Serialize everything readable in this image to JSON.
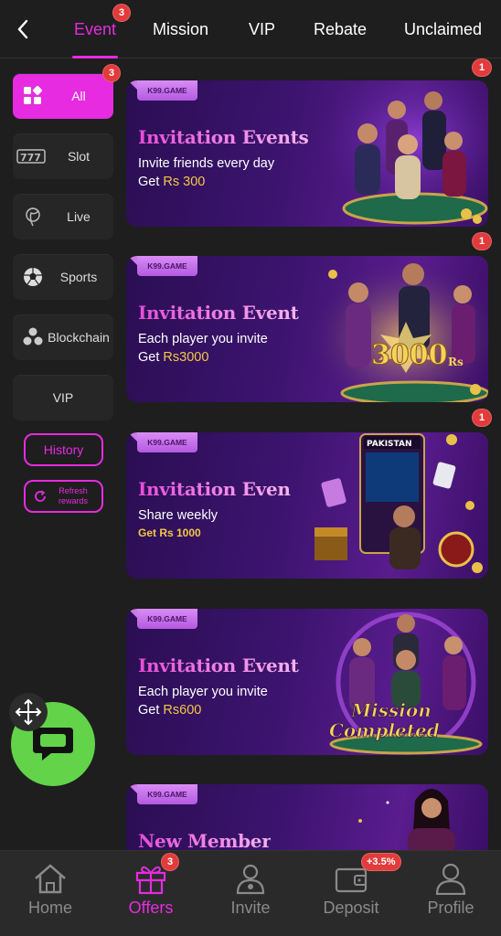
{
  "top_tabs": [
    {
      "label": "Event",
      "badge": "3",
      "active": true
    },
    {
      "label": "Mission"
    },
    {
      "label": "VIP"
    },
    {
      "label": "Rebate"
    },
    {
      "label": "Unclaimed"
    }
  ],
  "sidebar": {
    "items": [
      {
        "label": "All",
        "badge": "3",
        "icon": "grid-icon",
        "active": true
      },
      {
        "label": "Slot",
        "icon": "slot-777-icon"
      },
      {
        "label": "Live",
        "icon": "live-dealer-icon"
      },
      {
        "label": "Sports",
        "icon": "soccer-ball-icon"
      },
      {
        "label": "Blockchain",
        "icon": "blockchain-icon"
      },
      {
        "label": "VIP"
      }
    ],
    "history_label": "History",
    "refresh_label": "Refresh rewards"
  },
  "banners": [
    {
      "brand": "K99.GAME",
      "title": "Invitation Events",
      "line1": "Invite friends every day",
      "line2_prefix": "Get ",
      "line2_amount": "Rs 300",
      "badge": "1"
    },
    {
      "brand": "K99.GAME",
      "title": "Invitation Event",
      "line1": "Each player you invite",
      "line2_prefix": "Get ",
      "line2_amount": "Rs3000",
      "badge": "1",
      "art_text": "3000",
      "art_sub": "Rs"
    },
    {
      "brand": "K99.GAME",
      "title": "Invitation Even",
      "line1": "Share weekly",
      "line2_prefix": "",
      "line2_amount": "Get Rs 1000",
      "badge": "1",
      "art_text": "PAKISTAN"
    },
    {
      "brand": "K99.GAME",
      "title": "Invitation Event",
      "line1": "Each player you invite",
      "line2_prefix": "Get ",
      "line2_amount": "Rs600",
      "art_text": "Mission",
      "art_text2": "Completed"
    },
    {
      "brand": "K99.GAME",
      "title": "New Member"
    }
  ],
  "bottom_nav": [
    {
      "label": "Home",
      "icon": "home-icon"
    },
    {
      "label": "Offers",
      "icon": "gift-icon",
      "badge": "3",
      "active": true
    },
    {
      "label": "Invite",
      "icon": "invite-icon"
    },
    {
      "label": "Deposit",
      "icon": "wallet-icon",
      "badge": "+3.5%"
    },
    {
      "label": "Profile",
      "icon": "profile-icon"
    }
  ],
  "colors": {
    "accent": "#e62be0",
    "badge": "#e23b3b",
    "gold": "#f3c846",
    "chat": "#63d34a"
  }
}
